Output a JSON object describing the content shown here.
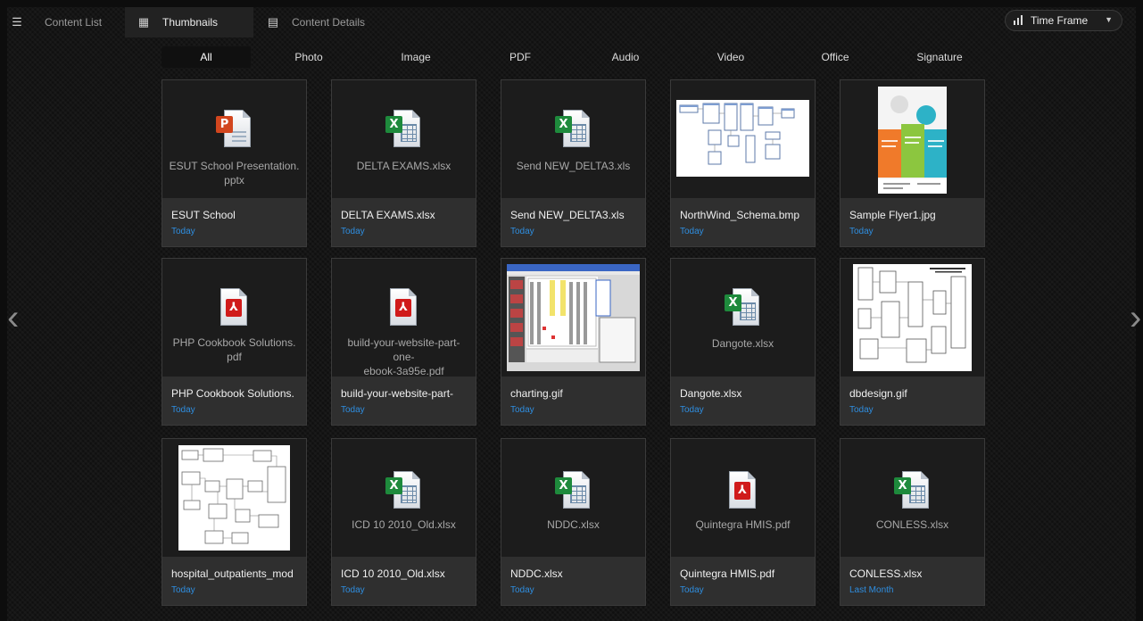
{
  "view_tabs": [
    {
      "label": "Content List",
      "icon": "list-icon"
    },
    {
      "label": "Thumbnails",
      "icon": "grid-icon",
      "active": true
    },
    {
      "label": "Content Details",
      "icon": "details-icon"
    }
  ],
  "time_frame": {
    "label": "Time Frame",
    "icon": "bar-chart-icon"
  },
  "filters": [
    "All",
    "Photo",
    "Image",
    "PDF",
    "Audio",
    "Video",
    "Office",
    "Signature"
  ],
  "active_filter": "All",
  "items": [
    {
      "type": "ppt",
      "file": "ESUT School Presentation.pptx",
      "thumb_lines": [
        "ESUT School Presentation.",
        "pptx"
      ],
      "title": "ESUT School",
      "date": "Today"
    },
    {
      "type": "xls",
      "file": "DELTA EXAMS.xlsx",
      "thumb_lines": [
        "DELTA EXAMS.xlsx"
      ],
      "title": "DELTA EXAMS.xlsx",
      "date": "Today"
    },
    {
      "type": "xls",
      "file": "Send NEW_DELTA3.xls",
      "thumb_lines": [
        "Send NEW_DELTA3.xls"
      ],
      "title": "Send NEW_DELTA3.xls",
      "date": "Today"
    },
    {
      "type": "image",
      "file": "NorthWind_Schema.bmp",
      "title": "NorthWind_Schema.bmp",
      "date": "Today"
    },
    {
      "type": "image",
      "file": "Sample Flyer1.jpg",
      "title": "Sample Flyer1.jpg",
      "date": "Today"
    },
    {
      "type": "pdf",
      "file": "PHP Cookbook Solutions.pdf",
      "thumb_lines": [
        "PHP Cookbook Solutions.",
        "pdf"
      ],
      "title": "PHP Cookbook Solutions.",
      "date": "Today"
    },
    {
      "type": "pdf",
      "file": "build-your-website-part-one-ebook-3a95e.pdf",
      "thumb_lines": [
        "build-your-website-part-one-",
        "ebook-3a95e.pdf"
      ],
      "title": "build-your-website-part-",
      "date": "Today"
    },
    {
      "type": "image",
      "file": "charting.gif",
      "title": "charting.gif",
      "date": "Today"
    },
    {
      "type": "xls",
      "file": "Dangote.xlsx",
      "thumb_lines": [
        "Dangote.xlsx"
      ],
      "title": "Dangote.xlsx",
      "date": "Today"
    },
    {
      "type": "image",
      "file": "dbdesign.gif",
      "title": "dbdesign.gif",
      "date": "Today"
    },
    {
      "type": "image",
      "file": "hospital_outpatients_mod",
      "title": "hospital_outpatients_mod",
      "date": "Today"
    },
    {
      "type": "xls",
      "file": "ICD 10 2010_Old.xlsx",
      "thumb_lines": [
        "ICD 10 2010_Old.xlsx"
      ],
      "title": "ICD 10 2010_Old.xlsx",
      "date": "Today"
    },
    {
      "type": "xls",
      "file": "NDDC.xlsx",
      "thumb_lines": [
        "NDDC.xlsx"
      ],
      "title": "NDDC.xlsx",
      "date": "Today"
    },
    {
      "type": "pdf",
      "file": "Quintegra HMIS.pdf",
      "thumb_lines": [
        "Quintegra HMIS.pdf"
      ],
      "title": "Quintegra HMIS.pdf",
      "date": "Today"
    },
    {
      "type": "xls",
      "file": "CONLESS.xlsx",
      "thumb_lines": [
        "CONLESS.xlsx"
      ],
      "title": "CONLESS.xlsx",
      "date": "Last Month"
    }
  ],
  "colors": {
    "accent": "#2f8ee0",
    "background": "#151515",
    "card": "#222222"
  }
}
